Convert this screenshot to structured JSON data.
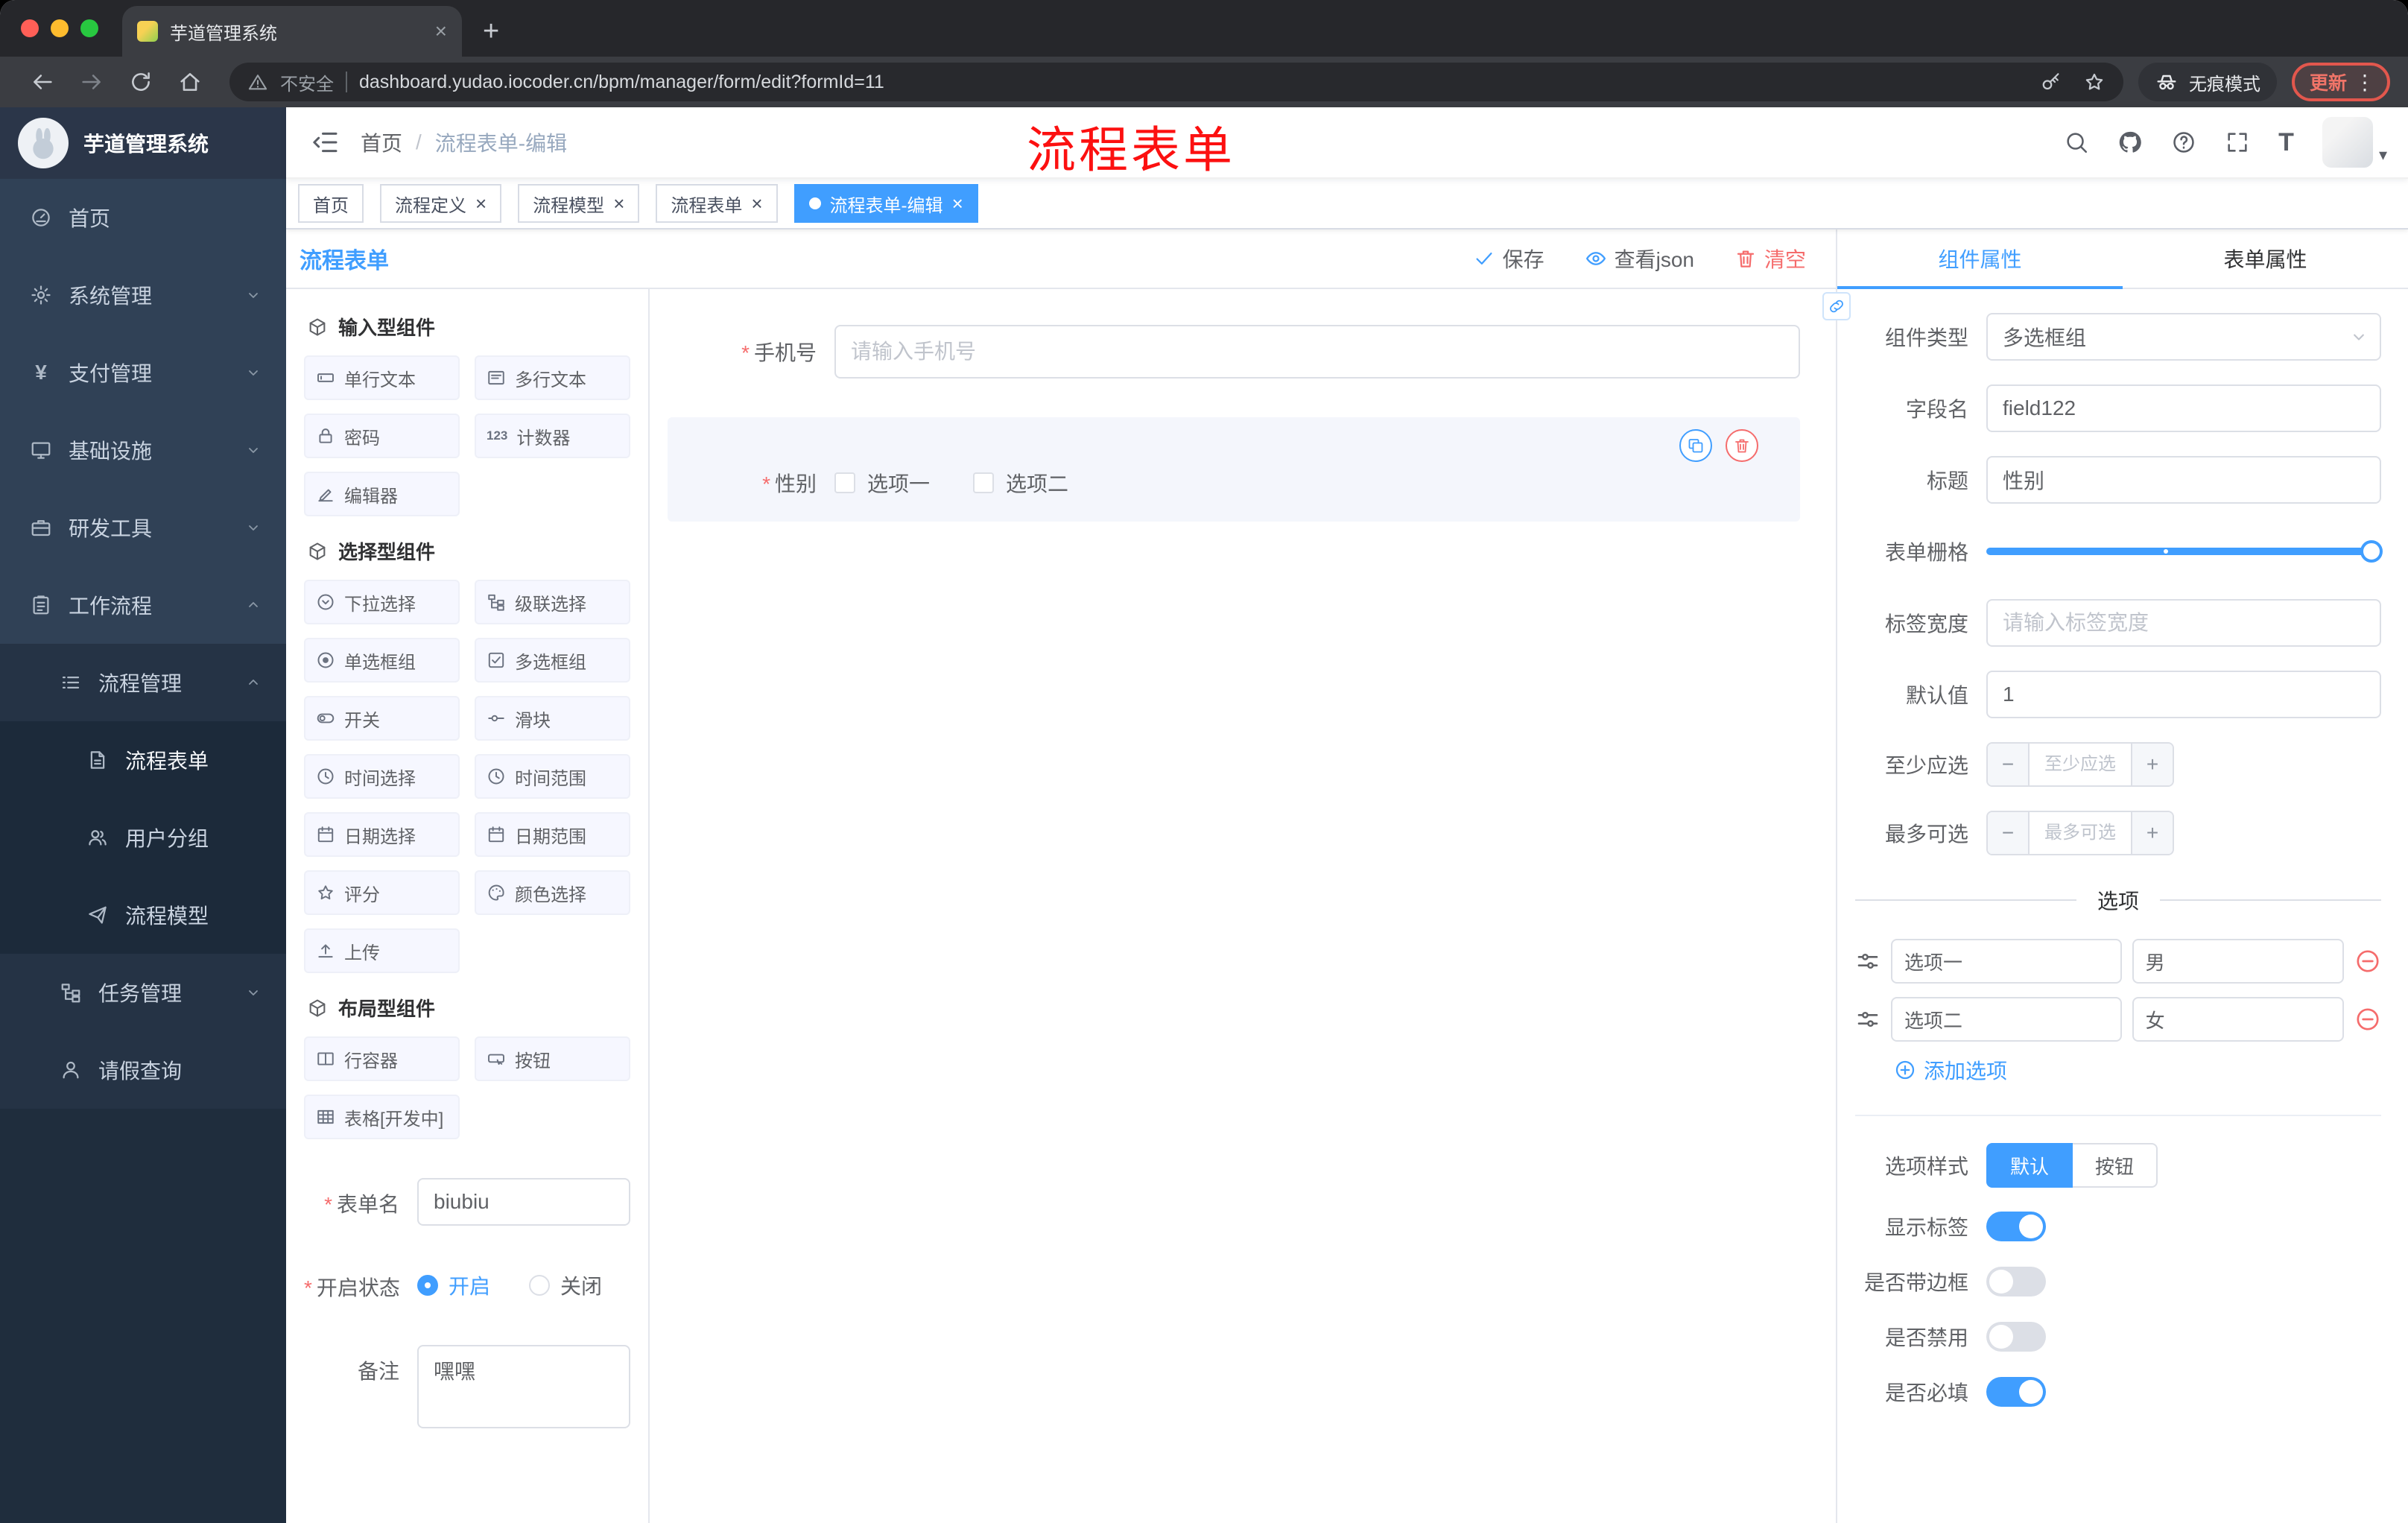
{
  "glyphs": {
    "close": "×",
    "plus": "+",
    "kebab": "⋮",
    "caret": "▾",
    "req": "*",
    "yen": "¥",
    "fontsize": "T",
    "minus": "−",
    "counter": "123",
    "breadcrumb_sep": "/"
  },
  "browser": {
    "tab_title": "芋道管理系统",
    "security": "不安全",
    "url": "dashboard.yudao.iocoder.cn/bpm/manager/form/edit?formId=11",
    "incognito": "无痕模式",
    "update": "更新"
  },
  "sidebar": {
    "title": "芋道管理系统",
    "items": {
      "home": "首页",
      "system": "系统管理",
      "pay": "支付管理",
      "infra": "基础设施",
      "dev": "研发工具",
      "workflow": "工作流程",
      "process_mgmt": "流程管理",
      "process_form": "流程表单",
      "user_group": "用户分组",
      "process_model": "流程模型",
      "task_mgmt": "任务管理",
      "leave_query": "请假查询"
    }
  },
  "header": {
    "breadcrumb": {
      "home": "首页",
      "current": "流程表单-编辑"
    },
    "annotation": "流程表单"
  },
  "tags": {
    "home": "首页",
    "def": "流程定义",
    "model": "流程模型",
    "form": "流程表单",
    "edit": "流程表单-编辑"
  },
  "designer": {
    "title": "流程表单",
    "save": "保存",
    "view_json": "查看json",
    "clear": "清空",
    "sections": {
      "input": "输入型组件",
      "select": "选择型组件",
      "layout": "布局型组件"
    },
    "components": {
      "input_single": "单行文本",
      "input_multi": "多行文本",
      "password": "密码",
      "counter": "计数器",
      "editor": "编辑器",
      "select": "下拉选择",
      "cascader": "级联选择",
      "radio_group": "单选框组",
      "checkbox_group": "多选框组",
      "switch": "开关",
      "slider": "滑块",
      "time": "时间选择",
      "time_range": "时间范围",
      "date": "日期选择",
      "date_range": "日期范围",
      "rate": "评分",
      "color": "颜色选择",
      "upload": "上传",
      "row": "行容器",
      "button": "按钮",
      "table": "表格[开发中]"
    },
    "meta": {
      "form_name_label": "表单名",
      "form_name_value": "biubiu",
      "status_label": "开启状态",
      "status_on": "开启",
      "status_off": "关闭",
      "remark_label": "备注",
      "remark_value": "嘿嘿"
    }
  },
  "canvas": {
    "phone_label": "手机号",
    "phone_placeholder": "请输入手机号",
    "gender_label": "性别",
    "option1": "选项一",
    "option2": "选项二"
  },
  "props": {
    "tab_component": "组件属性",
    "tab_form": "表单属性",
    "type_label": "组件类型",
    "type_value": "多选框组",
    "field_label": "字段名",
    "field_value": "field122",
    "title_label": "标题",
    "title_value": "性别",
    "grid_label": "表单栅格",
    "width_label": "标签宽度",
    "width_placeholder": "请输入标签宽度",
    "default_label": "默认值",
    "default_value": "1",
    "min_label": "至少应选",
    "min_placeholder": "至少应选",
    "max_label": "最多可选",
    "max_placeholder": "最多可选",
    "options_divider": "选项",
    "opt1_label": "选项一",
    "opt1_value": "男",
    "opt2_label": "选项二",
    "opt2_value": "女",
    "add_option": "添加选项",
    "style_label": "选项样式",
    "style_default": "默认",
    "style_button": "按钮",
    "show_label": "显示标签",
    "border_label": "是否带边框",
    "disabled_label": "是否禁用",
    "required_label": "是否必填"
  }
}
